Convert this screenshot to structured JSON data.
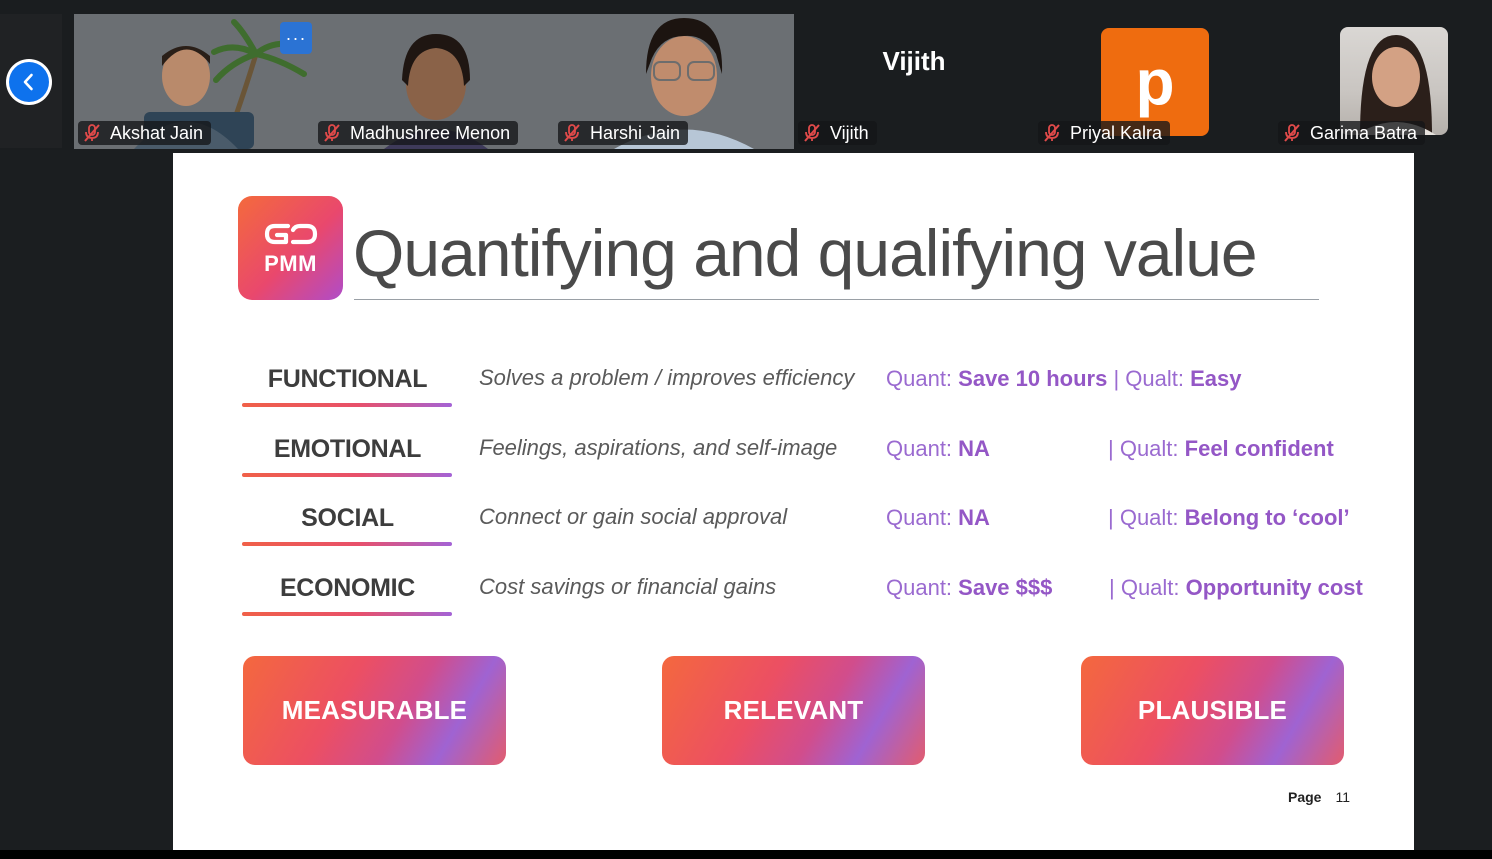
{
  "participants": [
    {
      "name": "Akshat Jain",
      "type": "video"
    },
    {
      "name": "Madhushree Menon",
      "type": "video"
    },
    {
      "name": "Harshi Jain",
      "type": "video"
    },
    {
      "name": "Vijith",
      "type": "name",
      "display": "Vijith"
    },
    {
      "name": "Priyal Kalra",
      "type": "avatar",
      "initial": "p",
      "color": "#ef6c0f"
    },
    {
      "name": "Garima Batra",
      "type": "video"
    }
  ],
  "controls": {
    "more_label": "···"
  },
  "slide": {
    "logo": {
      "mark": "GO",
      "text": "PMM"
    },
    "title": "Quantifying and qualifying value",
    "rows": [
      {
        "label": "FUNCTIONAL",
        "desc": "Solves a problem / improves efficiency",
        "quant_prefix": "Quant: ",
        "quant_value": "Save 10 hours",
        "qual_prefix": " | Qualt: ",
        "qual_value": "Easy"
      },
      {
        "label": "EMOTIONAL",
        "desc": "Feelings, aspirations, and self-image",
        "quant_prefix": "Quant: ",
        "quant_value": "NA",
        "qual_prefix": "| Qualt: ",
        "qual_value": "Feel confident"
      },
      {
        "label": "SOCIAL",
        "desc": "Connect or gain social approval",
        "quant_prefix": "Quant: ",
        "quant_value": "NA",
        "qual_prefix": "| Qualt: ",
        "qual_value": "Belong to ‘cool’"
      },
      {
        "label": "ECONOMIC",
        "desc": "Cost savings or financial gains",
        "quant_prefix": "Quant: ",
        "quant_value": "Save $$$",
        "qual_prefix": "| Qualt: ",
        "qual_value": "Opportunity cost"
      }
    ],
    "pills": [
      "MEASURABLE",
      "RELEVANT",
      "PLAUSIBLE"
    ],
    "page_label": "Page",
    "page_number": "11"
  },
  "colors": {
    "accent_purple": "#9457c6",
    "accent_orange": "#f06048",
    "zoom_blue": "#0e72ed"
  }
}
